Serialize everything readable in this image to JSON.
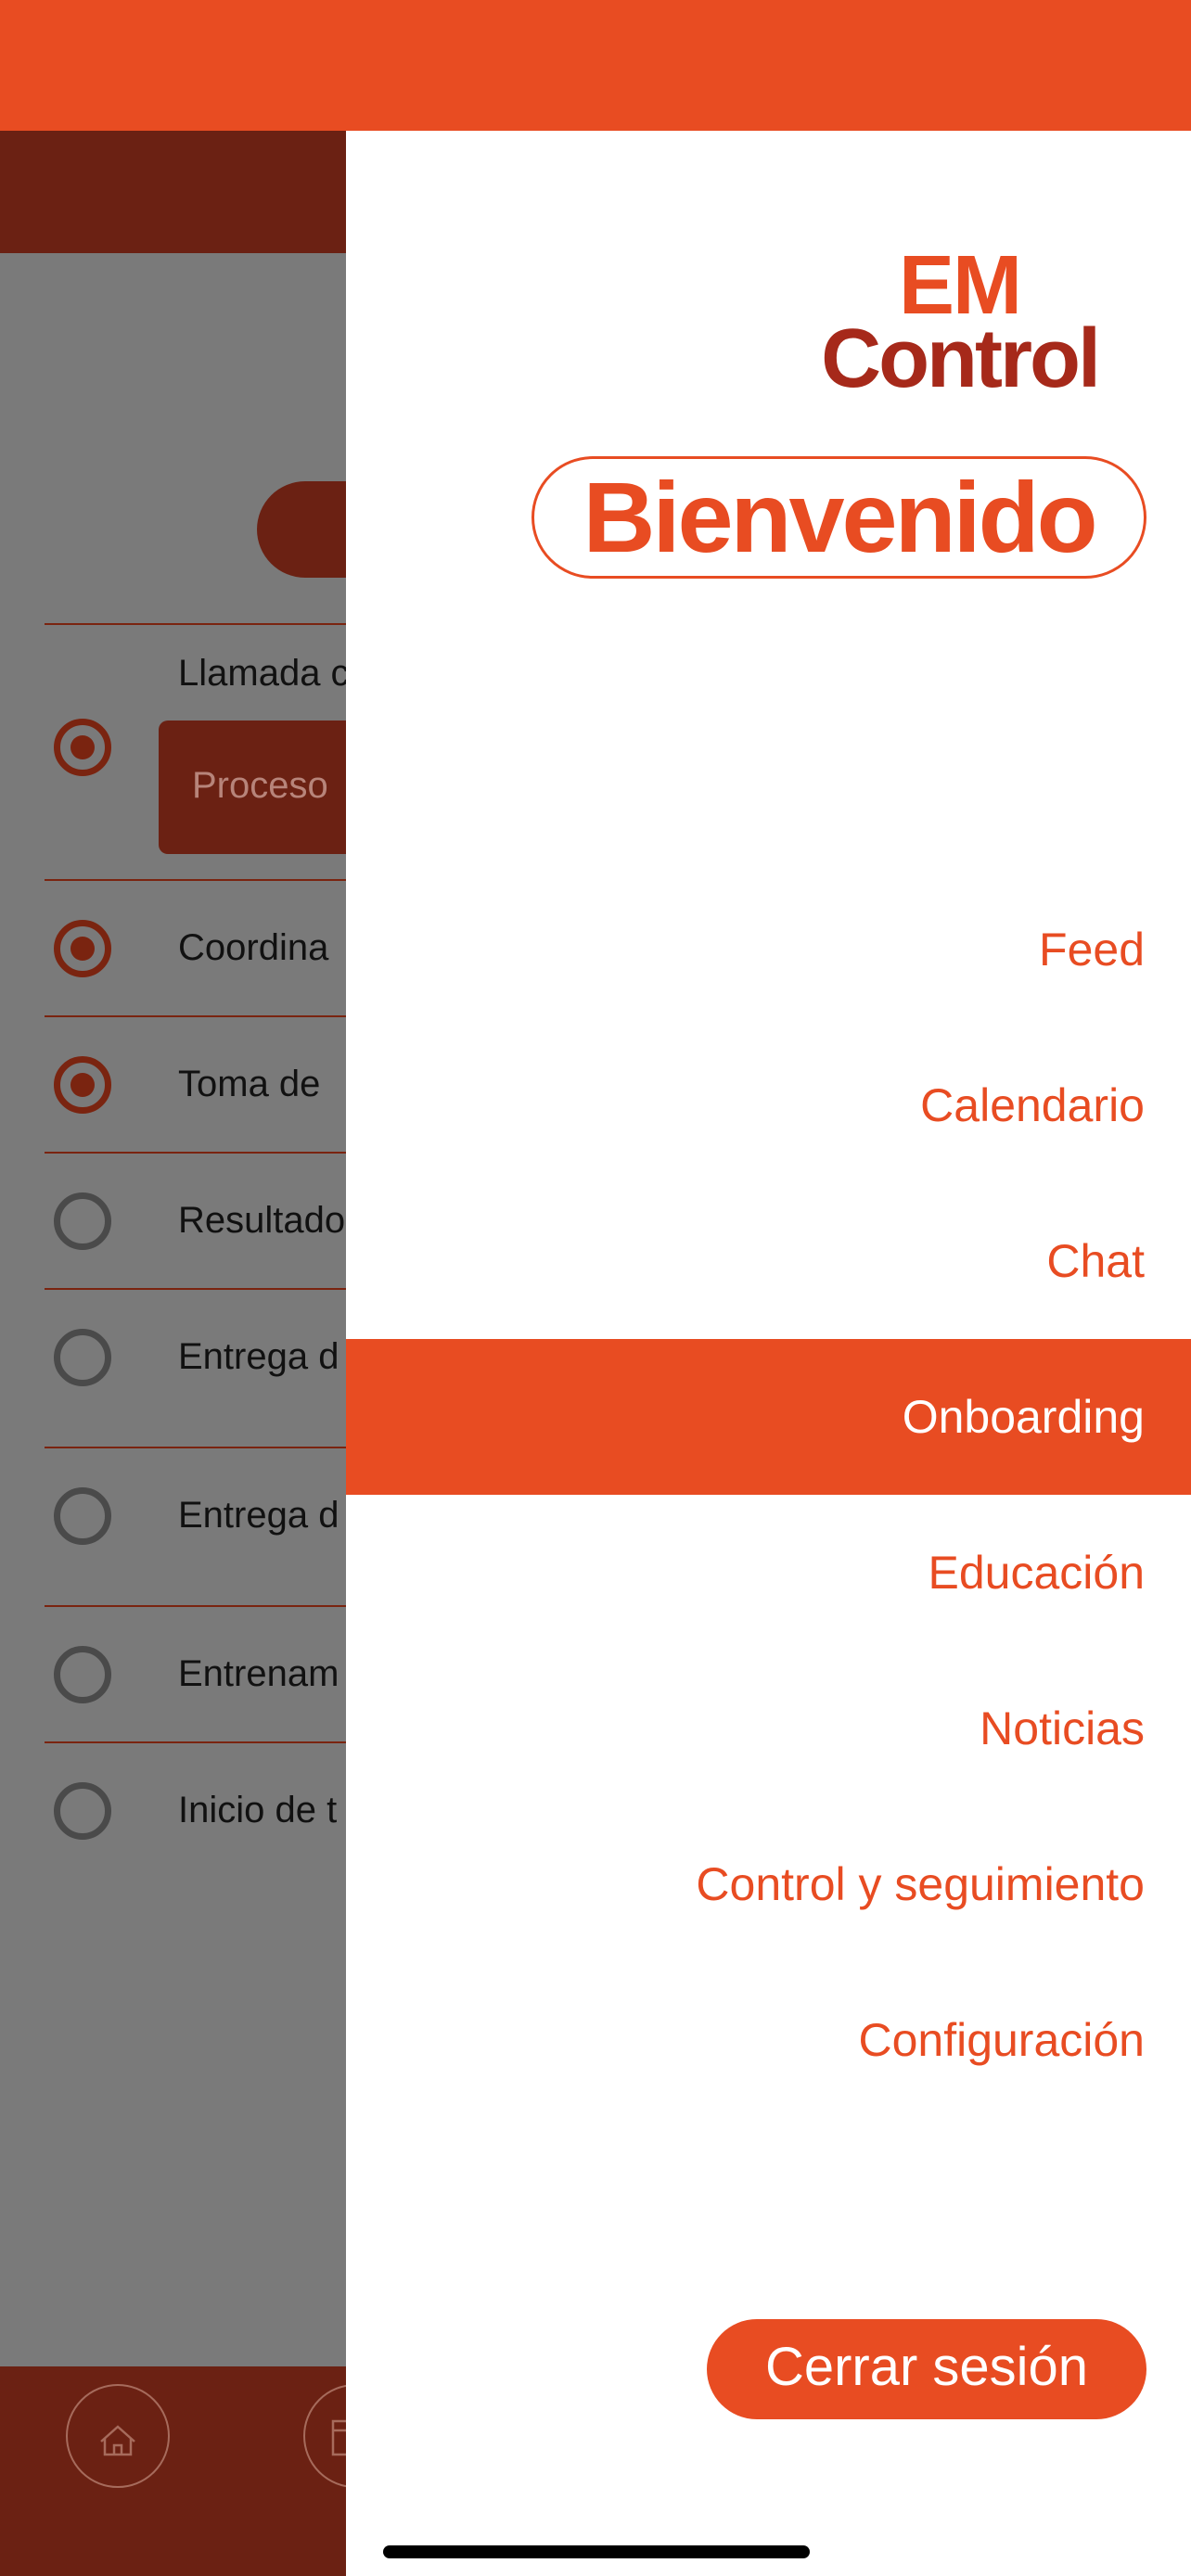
{
  "background_screen": {
    "step_first_label": "Llamada c",
    "process_label": "Proceso",
    "steps": [
      {
        "label": "Coordina",
        "done": true
      },
      {
        "label": "Toma de",
        "done": true
      },
      {
        "label": "Resultado",
        "done": false
      },
      {
        "label": "Entrega d",
        "done": false
      },
      {
        "label": "Entrega d",
        "done": false
      },
      {
        "label": "Entrenam",
        "done": false
      },
      {
        "label": "Inicio de t",
        "done": false
      }
    ]
  },
  "drawer": {
    "logo_line1": "EM",
    "logo_line2": "Control",
    "welcome": "Bienvenido",
    "menu": [
      {
        "label": "Feed",
        "active": false
      },
      {
        "label": "Calendario",
        "active": false
      },
      {
        "label": "Chat",
        "active": false
      },
      {
        "label": "Onboarding",
        "active": true
      },
      {
        "label": "Educación",
        "active": false
      },
      {
        "label": "Noticias",
        "active": false
      },
      {
        "label": "Control y seguimiento",
        "active": false
      },
      {
        "label": "Configuración",
        "active": false
      }
    ],
    "logout": "Cerrar sesión"
  },
  "colors": {
    "accent": "#E84C22",
    "dark_accent": "#6B2113",
    "logo_dark": "#A6291A"
  }
}
